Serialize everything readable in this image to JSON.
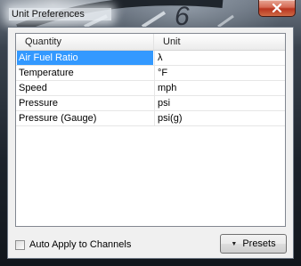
{
  "window": {
    "title": "Unit Preferences"
  },
  "grid": {
    "columns": [
      "Quantity",
      "Unit"
    ],
    "rows": [
      {
        "quantity": "Air Fuel Ratio",
        "unit": "λ",
        "selected": true
      },
      {
        "quantity": "Temperature",
        "unit": "°F",
        "selected": false
      },
      {
        "quantity": "Speed",
        "unit": "mph",
        "selected": false
      },
      {
        "quantity": "Pressure",
        "unit": "psi",
        "selected": false
      },
      {
        "quantity": "Pressure (Gauge)",
        "unit": "psi(g)",
        "selected": false
      }
    ]
  },
  "footer": {
    "auto_apply_label": "Auto Apply to Channels",
    "auto_apply_checked": false,
    "presets_label": "Presets"
  },
  "colors": {
    "selection": "#3399ff",
    "close_button": "#c7432b"
  }
}
